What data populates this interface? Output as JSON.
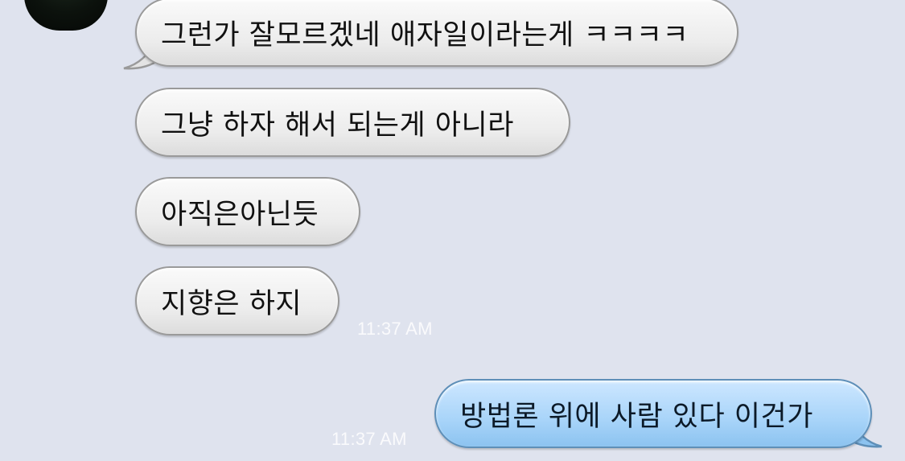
{
  "conversation": {
    "received": [
      "그런가 잘모르겠네 애자일이라는게 ㅋㅋㅋㅋ",
      "그냥 하자 해서 되는게 아니라",
      "아직은아닌듯",
      "지향은 하지"
    ],
    "received_time": "11:37 AM",
    "sent": [
      "방법론 위에 사람 있다 이건가"
    ],
    "sent_time": "11:37 AM"
  },
  "colors": {
    "background": "#dfe3ee",
    "incoming_bubble": "#eeeeee",
    "outgoing_bubble": "#a8d4f9"
  },
  "icons": {
    "avatar": "contact-avatar"
  }
}
